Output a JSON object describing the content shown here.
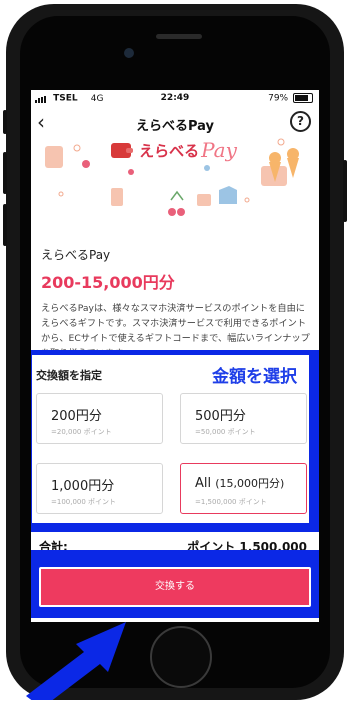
{
  "status_bar": {
    "carrier": "TSEL",
    "network": "4G",
    "time": "22:49",
    "battery": "79%"
  },
  "nav": {
    "title": "えらべるPay"
  },
  "brand": {
    "jp": "えらべる",
    "pay": "Pay"
  },
  "product": {
    "name": "えらべるPay",
    "range": "200-15,000円分",
    "description": "えらべるPayは、様々なスマホ決済サービスのポイントを自由にえらべるギフトです。スマホ決済サービスで利用できるポイントから、ECサイトで使えるギフトコードまで、幅広いラインナップを取り揃えています。"
  },
  "exchange": {
    "label": "交換額を指定",
    "badge": "金額を選択",
    "options": [
      {
        "main": "200円分",
        "extra": "",
        "sub": "=20,000 ポイント"
      },
      {
        "main": "500円分",
        "extra": "",
        "sub": "=50,000 ポイント"
      },
      {
        "main": "1,000円分",
        "extra": "",
        "sub": "=100,000 ポイント"
      },
      {
        "main": "All",
        "extra": "(15,000円分)",
        "sub": "=1,500,000 ポイント"
      }
    ],
    "selected_index": 3
  },
  "total": {
    "label": "合計:",
    "value": "ポイント 1,500,000"
  },
  "button": {
    "label": "交換する"
  },
  "colors": {
    "accent": "#e83a5d",
    "highlight": "#0b28e6"
  }
}
